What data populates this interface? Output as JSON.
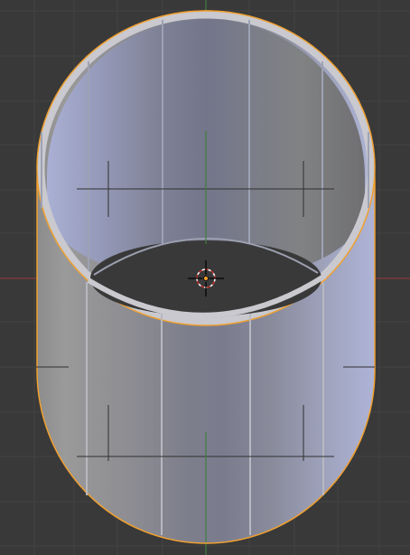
{
  "app": {
    "type": "3d-viewport",
    "mode": "edit",
    "selected_object": "cylinder"
  },
  "colors": {
    "background": "#393939",
    "grid_minor": "#434343",
    "grid_major": "#4a4a4a",
    "axis_x": "#8a3a3a",
    "axis_y": "#3f7f3f",
    "selection_outline": "#f0a030",
    "cursor_ring": "#ffffff",
    "cursor_cross": "#000000",
    "origin_dot": "#f0a030"
  },
  "object": {
    "shape": "open-cylinder",
    "segments": 32,
    "show_normals_lines": true
  }
}
